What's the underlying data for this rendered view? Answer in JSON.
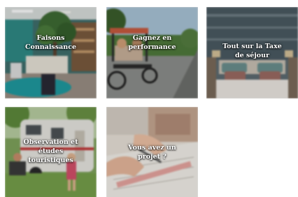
{
  "tiles": [
    {
      "label": "Faisons\nConnaissance",
      "scene": "office-interior-icon"
    },
    {
      "label": "Gagnez en\nperformance",
      "scene": "pedal-cart-icon"
    },
    {
      "label": "Tout sur la Taxe\nde séjour",
      "scene": "hotel-bed-icon"
    },
    {
      "label": "Observation et\nétudes\ntouristiques",
      "scene": "camper-van-icon"
    },
    {
      "label": "Vous avez un\nprojet ?",
      "scene": "drafting-plans-icon"
    }
  ]
}
